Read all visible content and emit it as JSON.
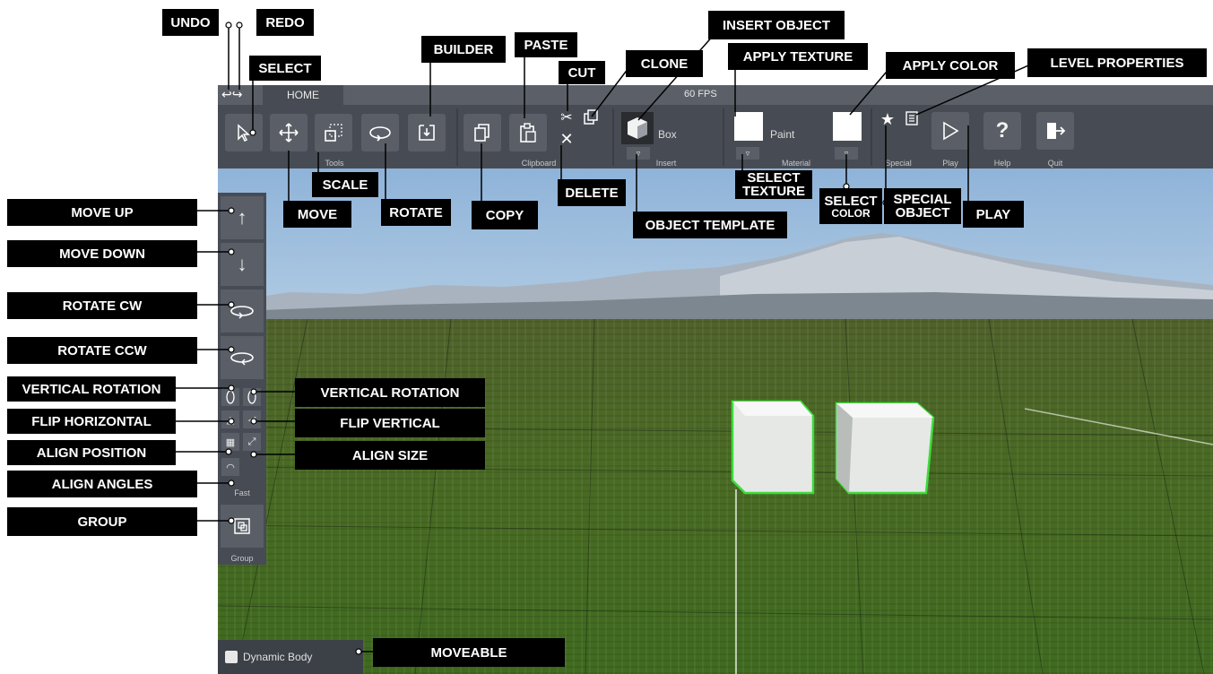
{
  "tabbar": {
    "tab": "HOME",
    "fps": "60 FPS",
    "undo_glyph": "↩",
    "redo_glyph": "↪"
  },
  "toolbar": {
    "groups": {
      "tools": "Tools",
      "clipboard": "Clipboard",
      "insert": "Insert",
      "material": "Material",
      "special": "Special",
      "play": "Play",
      "help": "Help",
      "quit": "Quit"
    },
    "insert_shape": "Box",
    "material_name": "Paint",
    "help_glyph": "?"
  },
  "left_panel": {
    "fast_label": "Fast",
    "group_label": "Group"
  },
  "dynamic_body": {
    "label": "Dynamic Body"
  },
  "callouts": {
    "undo": "UNDO",
    "redo": "REDO",
    "select": "SELECT",
    "builder": "BUILDER",
    "paste": "PASTE",
    "cut": "CUT",
    "clone": "CLONE",
    "insert_object": "INSERT OBJECT",
    "apply_texture": "APPLY TEXTURE",
    "apply_color": "APPLY COLOR",
    "level_properties": "LEVEL PROPERTIES",
    "scale": "SCALE",
    "move": "MOVE",
    "rotate": "ROTATE",
    "copy": "COPY",
    "delete": "DELETE",
    "object_template": "OBJECT TEMPLATE",
    "select_texture_1": "SELECT",
    "select_texture_2": "TEXTURE",
    "select_color_1": "SELECT",
    "select_color_2": "COLOR",
    "special_object_1": "SPECIAL",
    "special_object_2": "OBJECT",
    "play": "PLAY",
    "move_up": "MOVE UP",
    "move_down": "MOVE DOWN",
    "rotate_cw": "ROTATE CW",
    "rotate_ccw": "ROTATE CCW",
    "vertical_rotation_left": "VERTICAL ROTATION",
    "vertical_rotation_right": "VERTICAL ROTATION",
    "flip_horizontal": "FLIP HORIZONTAL",
    "flip_vertical": "FLIP VERTICAL",
    "align_position": "ALIGN POSITION",
    "align_size": "ALIGN SIZE",
    "align_angles": "ALIGN ANGLES",
    "group": "GROUP",
    "moveable": "MOVEABLE"
  },
  "colors": {
    "toolbar_bg": "#474c54",
    "button_bg": "#5a5f67",
    "selection_outline": "#3cdc3c",
    "callout_bg": "#000000"
  },
  "icons": [
    "select-arrow-icon",
    "move-icon",
    "scale-icon",
    "rotate-icon",
    "builder-icon",
    "copy-icon",
    "paste-icon",
    "cut-icon",
    "delete-icon",
    "clone-icon",
    "box-icon",
    "star-icon",
    "level-properties-icon",
    "play-icon",
    "help-icon",
    "quit-icon",
    "arrow-up-icon",
    "arrow-down-icon",
    "rotate-cw-icon",
    "rotate-ccw-icon",
    "vertical-rotation-icon",
    "flip-horizontal-icon",
    "flip-vertical-icon",
    "align-position-icon",
    "align-size-icon",
    "align-angles-icon",
    "group-icon",
    "checkbox-icon"
  ]
}
